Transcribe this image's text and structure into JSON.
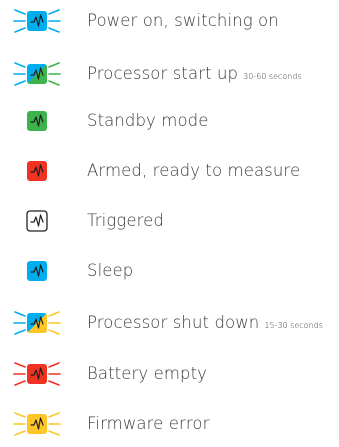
{
  "legend": {
    "items": [
      {
        "id": "power-on",
        "label": "Power on, switching on",
        "note": "",
        "icon": "heartbeat-icon",
        "fill": [
          "#00aeef"
        ],
        "border": "",
        "rays": "#00aeef"
      },
      {
        "id": "processor-start",
        "label": "Processor start up",
        "note": "30-60 seconds",
        "icon": "heartbeat-icon",
        "fill": [
          "#00aeef",
          "#3cb44b"
        ],
        "border": "",
        "rays": "#00aeef",
        "rays_right": "#3cb44b"
      },
      {
        "id": "standby",
        "label": "Standby mode",
        "note": "",
        "icon": "heartbeat-icon",
        "fill": [
          "#3cb44b"
        ],
        "border": "",
        "rays": ""
      },
      {
        "id": "armed",
        "label": "Armed, ready to measure",
        "note": "",
        "icon": "heartbeat-icon",
        "fill": [
          "#f03223"
        ],
        "border": "",
        "rays": ""
      },
      {
        "id": "triggered",
        "label": "Triggered",
        "note": "",
        "icon": "heartbeat-icon",
        "fill": [
          "#ffffff"
        ],
        "border": "#222222",
        "rays": ""
      },
      {
        "id": "sleep",
        "label": "Sleep",
        "note": "",
        "icon": "heartbeat-icon",
        "fill": [
          "#00aeef"
        ],
        "border": "",
        "rays": ""
      },
      {
        "id": "processor-shutdown",
        "label": "Processor shut down",
        "note": "15-30 seconds",
        "icon": "heartbeat-icon",
        "fill": [
          "#00aeef",
          "#ffc627"
        ],
        "border": "",
        "rays": "#00aeef",
        "rays_right": "#ffc627"
      },
      {
        "id": "battery-empty",
        "label": "Battery empty",
        "note": "",
        "icon": "heartbeat-icon",
        "fill": [
          "#f03223"
        ],
        "border": "",
        "rays": "#f03223"
      },
      {
        "id": "firmware-error",
        "label": "Firmware error",
        "note": "",
        "icon": "heartbeat-icon",
        "fill": [
          "#ffc627"
        ],
        "border": "",
        "rays": "#ffc627"
      }
    ]
  }
}
